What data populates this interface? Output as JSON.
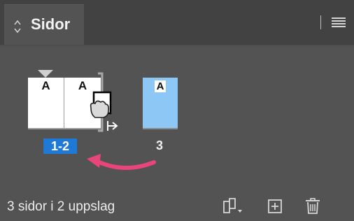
{
  "panel": {
    "title": "Sidor"
  },
  "pages": {
    "spread_masters": [
      "A",
      "A"
    ],
    "spread_label": "1-2",
    "single_master": "A",
    "single_label": "3"
  },
  "footer": {
    "status": "3 sidor i 2 uppslag"
  },
  "icons": {
    "collapse": "double-chevron-icon",
    "panel_menu": "hamburger-menu-icon",
    "edit_page_size": "page-size-icon",
    "new_page": "new-page-icon",
    "delete": "trash-icon",
    "cursor": "grab-hand-cursor-icon"
  },
  "colors": {
    "selected_label": "#1f7ad7",
    "selected_page": "#8cc7f5",
    "drag_arrow": "#e8457a"
  }
}
